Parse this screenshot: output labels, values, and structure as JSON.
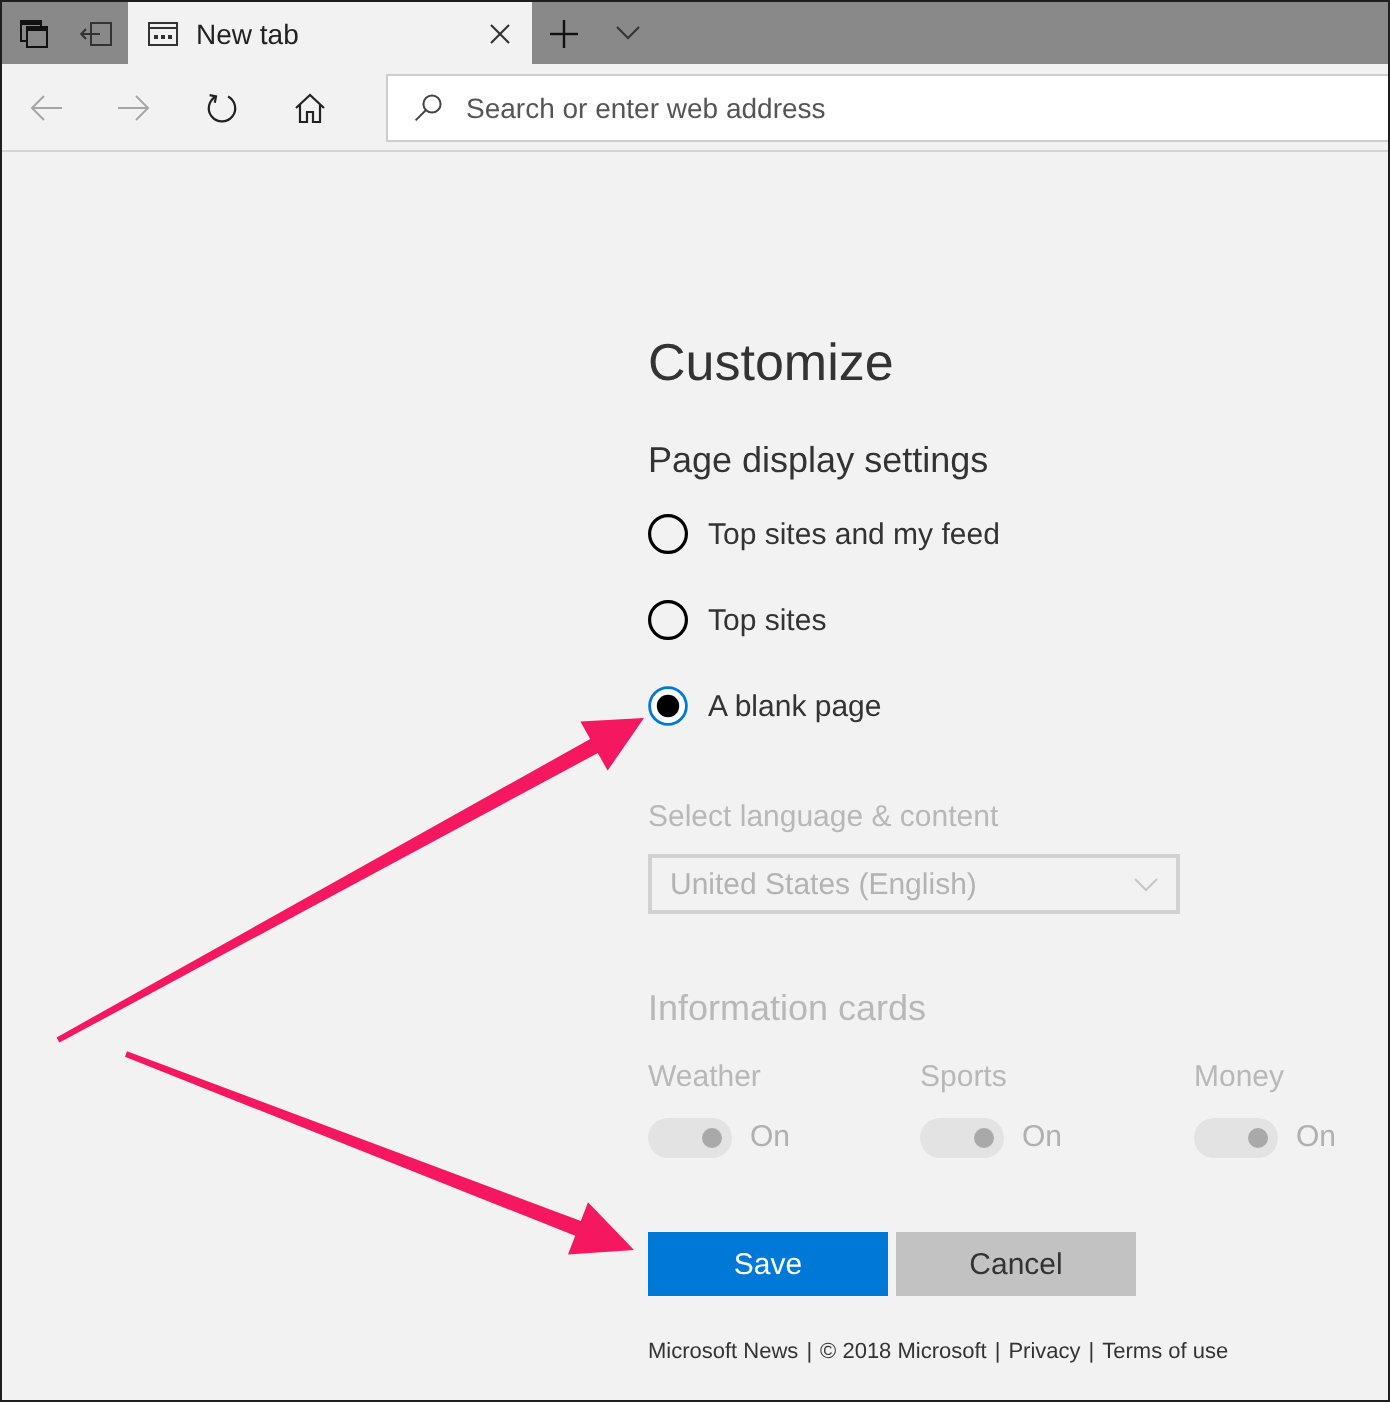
{
  "tab_strip": {
    "tabs": [
      {
        "title": "New tab",
        "selected": true
      }
    ]
  },
  "toolbar": {
    "nav_buttons": [
      {
        "kind": "back",
        "disabled": true
      },
      {
        "kind": "forward",
        "disabled": true
      },
      {
        "kind": "refresh",
        "disabled": false
      },
      {
        "kind": "home",
        "disabled": false
      }
    ],
    "address_bar": {
      "placeholder": "Search or enter web address"
    }
  },
  "customize": {
    "title": "Customize",
    "display_settings": {
      "heading": "Page display settings",
      "options": [
        {
          "label": "Top sites and my feed",
          "selected": false
        },
        {
          "label": "Top sites",
          "selected": false
        },
        {
          "label": "A blank page",
          "selected": true
        }
      ]
    },
    "language": {
      "label": "Select language & content",
      "value": "United States (English)",
      "disabled": true
    },
    "information_cards": {
      "heading": "Information cards",
      "disabled": true,
      "cards": [
        {
          "label": "Weather",
          "on": true,
          "state_text": "On"
        },
        {
          "label": "Sports",
          "on": true,
          "state_text": "On"
        },
        {
          "label": "Money",
          "on": true,
          "state_text": "On"
        }
      ]
    },
    "buttons": [
      {
        "kind": "primary",
        "label": "Save"
      },
      {
        "kind": "secondary",
        "label": "Cancel"
      }
    ],
    "footer": {
      "separator": "|",
      "items": [
        {
          "text": "Microsoft News"
        },
        {
          "text": "© 2018 Microsoft"
        },
        {
          "text": "Privacy"
        },
        {
          "text": "Terms of use"
        }
      ]
    }
  },
  "annotations": [
    {
      "kind": "arrow"
    },
    {
      "kind": "arrow"
    }
  ]
}
